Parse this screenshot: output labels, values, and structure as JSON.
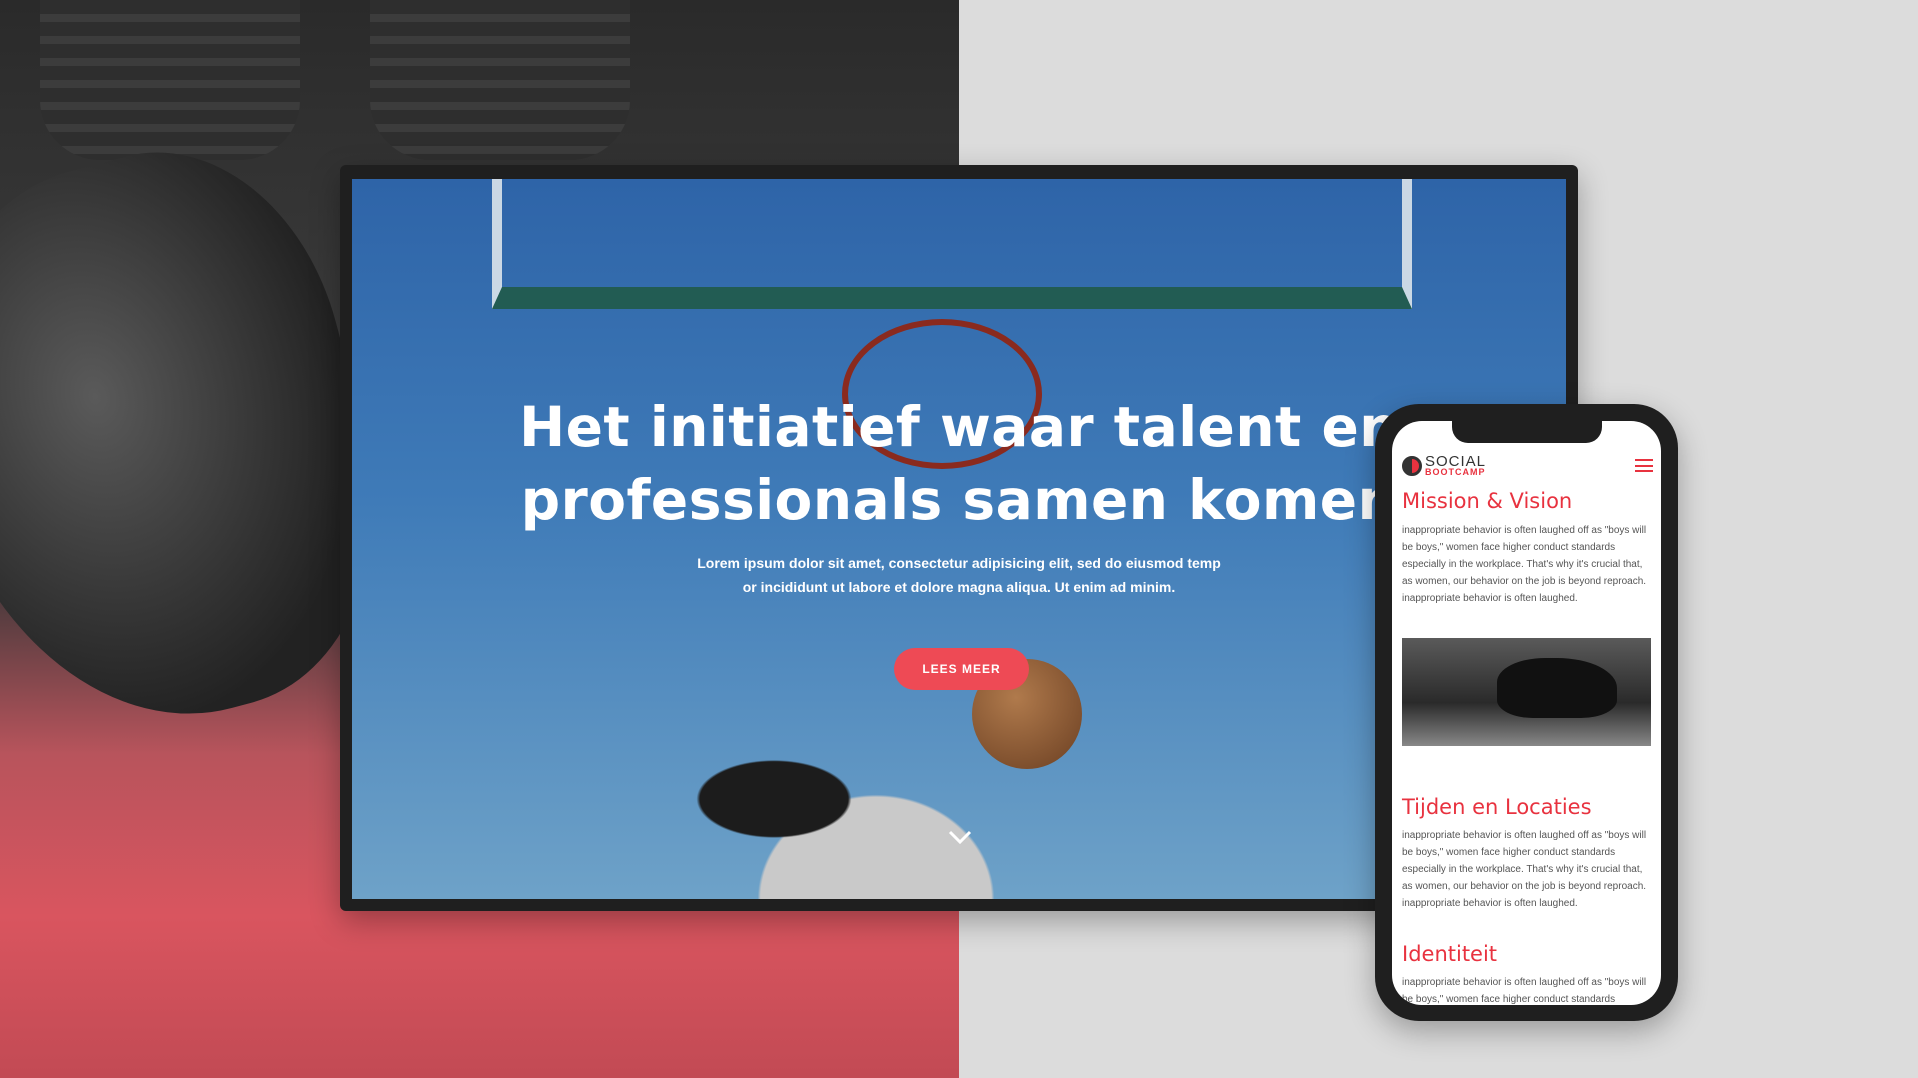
{
  "hero": {
    "headline_line1": "Het initiatief waar talent en",
    "headline_line2": "professionals samen komen",
    "sub_line1": "Lorem ipsum dolor sit amet, consectetur adipisicing elit, sed do eiusmod temp",
    "sub_line2": "or incididunt ut labore et dolore magna aliqua. Ut enim ad minim.",
    "button": "LEES MEER"
  },
  "phone": {
    "logo_top": "SOCIAL",
    "logo_bottom": "BOOTCAMP",
    "sections": [
      {
        "title": "Mission & Vision",
        "text": "inappropriate behavior is often laughed off as \"boys will be boys,\" women face higher conduct standards especially in the workplace. That's why it's crucial that, as women, our behavior on the job is beyond reproach. inappropriate behavior is often laughed."
      },
      {
        "title": "Tijden en Locaties",
        "text": "inappropriate behavior is often laughed off as \"boys will be boys,\" women face higher conduct standards especially in the workplace. That's why it's crucial that, as women, our behavior on the job is beyond reproach. inappropriate behavior is often laughed."
      },
      {
        "title": "Identiteit",
        "text": "inappropriate behavior is often laughed off as \"boys will be boys,\" women face higher conduct standards especially in"
      }
    ]
  },
  "colors": {
    "accent": "#e8323f",
    "button": "#ee4a55"
  }
}
